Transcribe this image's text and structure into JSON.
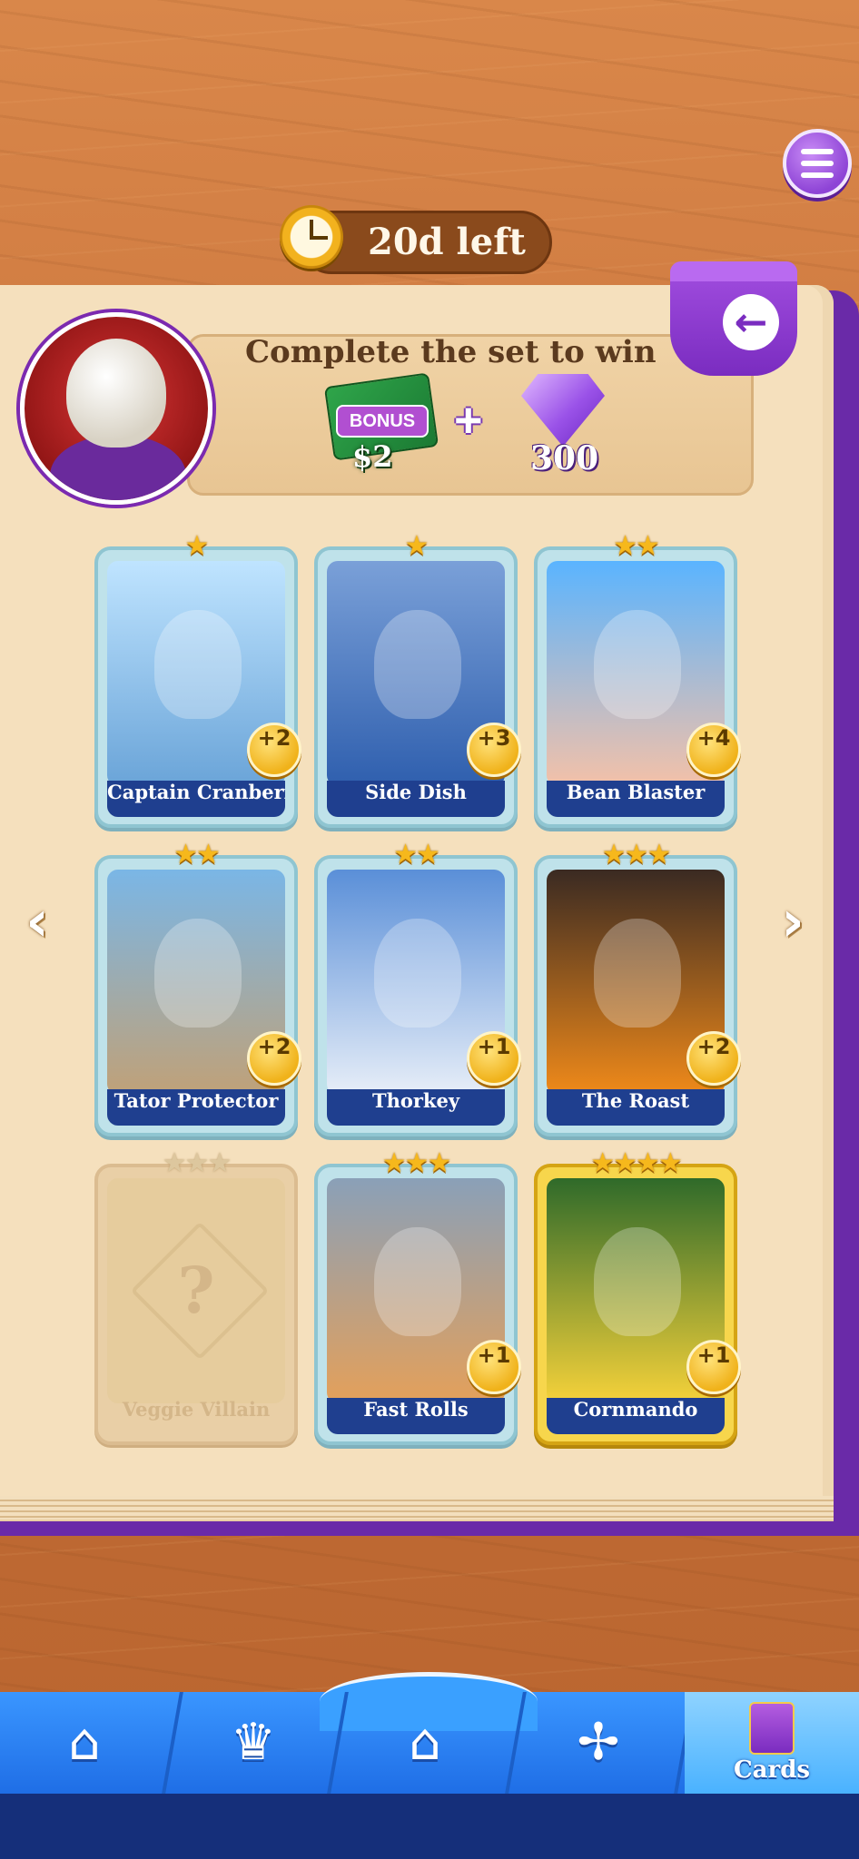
{
  "header": {
    "timer_text": "20d left"
  },
  "reward": {
    "title": "Complete the set to win",
    "bonus_label": "BONUS",
    "cash_amount": "$2",
    "plus": "+",
    "gem_amount": "300"
  },
  "cards": [
    {
      "name": "Captain Cranberry",
      "bonus": "+2",
      "stars": "★",
      "colors": [
        "#bfe4ff",
        "#6aa4d8"
      ]
    },
    {
      "name": "Side Dish",
      "bonus": "+3",
      "stars": "★",
      "colors": [
        "#7aa0d8",
        "#2f5fae"
      ]
    },
    {
      "name": "Bean Blaster",
      "bonus": "+4",
      "stars": "★★",
      "colors": [
        "#5ab4ff",
        "#f4c1a8"
      ]
    },
    {
      "name": "Tator Protector",
      "bonus": "+2",
      "stars": "★★",
      "colors": [
        "#7ab6e6",
        "#c0a178"
      ]
    },
    {
      "name": "Thorkey",
      "bonus": "+1",
      "stars": "★★",
      "colors": [
        "#5a8fd8",
        "#e7eef8"
      ]
    },
    {
      "name": "The Roast",
      "bonus": "+2",
      "stars": "★★★",
      "colors": [
        "#3a2a22",
        "#f08a1a"
      ]
    },
    {
      "name": "Veggie Villain",
      "bonus": "",
      "stars": "★★★",
      "colors": [
        "#e6cc9d",
        "#e6cc9d"
      ]
    },
    {
      "name": "Fast Rolls",
      "bonus": "+1",
      "stars": "★★★",
      "colors": [
        "#8aa0b8",
        "#e4a05a"
      ]
    },
    {
      "name": "Cornmando",
      "bonus": "+1",
      "stars": "★★★★",
      "colors": [
        "#2f6a2a",
        "#f6d23a"
      ]
    }
  ],
  "nav": {
    "prev_glyph": "‹",
    "next_glyph": "›",
    "back_glyph": "←"
  },
  "tabbar": {
    "shop_icon": "shop-icon",
    "trophy_icon": "trophy-icon",
    "home_icon": "home-icon",
    "windmill_icon": "windmill-icon",
    "cards_label": "Cards"
  },
  "colors": {
    "accent_purple": "#7a2cc0",
    "tab_blue": "#1f6ee6",
    "page_cream": "#f5e0bd"
  }
}
